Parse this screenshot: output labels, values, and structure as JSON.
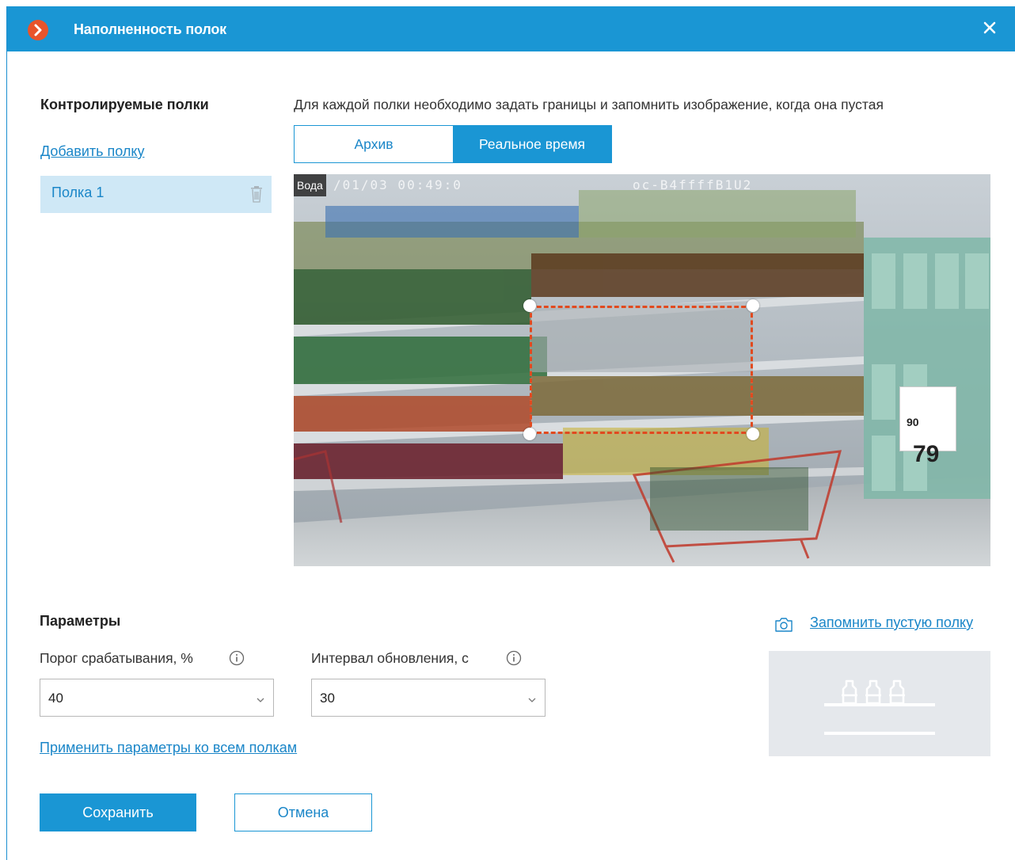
{
  "window": {
    "title": "Наполненность полок",
    "close_glyph": "✕"
  },
  "shelves_panel": {
    "heading": "Контролируемые полки",
    "add_link": "Добавить полку",
    "items": [
      {
        "label": "Полка 1",
        "selected": true
      }
    ]
  },
  "viewer": {
    "hint": "Для каждой полки необходимо задать границы и запомнить изображение, когда она пустая",
    "tabs": [
      {
        "label": "Архив",
        "active": false
      },
      {
        "label": "Реальное время",
        "active": true
      }
    ],
    "camera_label": "Вода",
    "timestamp_overlay": "/01/03 00:49:0",
    "camera_code_overlay": "oc-B4ffffB1U2",
    "price_tag": {
      "main": "79",
      "cents": "90"
    }
  },
  "params": {
    "heading": "Параметры",
    "threshold": {
      "label": "Порог срабатывания, %",
      "value": "40"
    },
    "interval": {
      "label": "Интервал обновления, с",
      "value": "30"
    },
    "apply_all_link": "Применить параметры ко всем полкам",
    "remember_empty_link": "Запомнить пустую полку"
  },
  "actions": {
    "save_label": "Сохранить",
    "cancel_label": "Отмена"
  },
  "colors": {
    "accent": "#1a96d4",
    "link": "#1a86c8",
    "selection_bg": "#cfe8f6",
    "roi_dash": "#e04a1f",
    "app_icon": "#e8542b"
  }
}
